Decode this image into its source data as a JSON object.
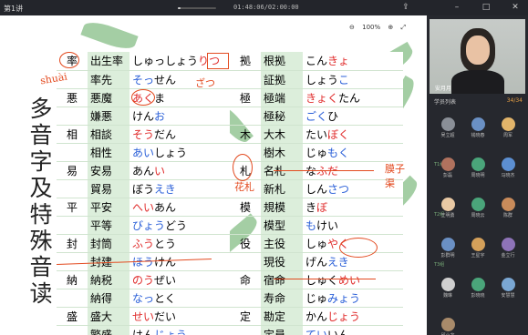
{
  "window": {
    "title": "第1讲",
    "timer": "01:48:06/02:00:00",
    "progress_fraction": 0.08
  },
  "window_icons": [
    "share-icon",
    "minimize-icon",
    "maximize-icon",
    "close-icon"
  ],
  "toolbar": {
    "zoom": "100%"
  },
  "slide": {
    "vertical_title": "多音字及特殊音读",
    "left_rows": [
      {
        "head": "率",
        "word": "出生率",
        "reading": [
          [
            "しゅっしょう",
            ""
          ],
          [
            "りつ",
            "red"
          ]
        ]
      },
      {
        "head": "",
        "word": "率先",
        "reading": [
          [
            "そっ",
            "blue"
          ],
          [
            "せん",
            ""
          ]
        ]
      },
      {
        "head": "悪",
        "word": "悪魔",
        "reading": [
          [
            "あく",
            "red"
          ],
          [
            "ま",
            ""
          ]
        ]
      },
      {
        "head": "",
        "word": "嫌悪",
        "reading": [
          [
            "けん",
            ""
          ],
          [
            "お",
            "blue"
          ]
        ]
      },
      {
        "head": "相",
        "word": "相談",
        "reading": [
          [
            "そう",
            "red"
          ],
          [
            "だん",
            ""
          ]
        ]
      },
      {
        "head": "",
        "word": "相性",
        "reading": [
          [
            "あい",
            "blue"
          ],
          [
            "しょう",
            ""
          ]
        ]
      },
      {
        "head": "易",
        "word": "安易",
        "reading": [
          [
            "あん",
            ""
          ],
          [
            "い",
            "red"
          ]
        ]
      },
      {
        "head": "",
        "word": "貿易",
        "reading": [
          [
            "ぼう",
            ""
          ],
          [
            "えき",
            "blue"
          ]
        ]
      },
      {
        "head": "平",
        "word": "平安",
        "reading": [
          [
            "へい",
            "red"
          ],
          [
            "あん",
            ""
          ]
        ]
      },
      {
        "head": "",
        "word": "平等",
        "reading": [
          [
            "びょう",
            "blue"
          ],
          [
            "どう",
            ""
          ]
        ]
      },
      {
        "head": "封",
        "word": "封筒",
        "reading": [
          [
            "ふう",
            "red"
          ],
          [
            "とう",
            ""
          ]
        ]
      },
      {
        "head": "",
        "word": "封建",
        "reading": [
          [
            "ほう",
            "blue"
          ],
          [
            "けん",
            ""
          ]
        ]
      },
      {
        "head": "納",
        "word": "納税",
        "reading": [
          [
            "のう",
            "red"
          ],
          [
            "ぜい",
            ""
          ]
        ]
      },
      {
        "head": "",
        "word": "納得",
        "reading": [
          [
            "なっ",
            "blue"
          ],
          [
            "とく",
            ""
          ]
        ]
      },
      {
        "head": "盛",
        "word": "盛大",
        "reading": [
          [
            "せい",
            "red"
          ],
          [
            "だい",
            ""
          ]
        ]
      },
      {
        "head": "",
        "word": "繁盛",
        "reading": [
          [
            "はん",
            ""
          ],
          [
            "じょう",
            "blue"
          ]
        ]
      }
    ],
    "right_rows": [
      {
        "head": "拠",
        "word": "根拠",
        "reading": [
          [
            "こん",
            ""
          ],
          [
            "きょ",
            "red"
          ]
        ]
      },
      {
        "head": "",
        "word": "証拠",
        "reading": [
          [
            "しょう",
            ""
          ],
          [
            "こ",
            "blue"
          ]
        ]
      },
      {
        "head": "極",
        "word": "極端",
        "reading": [
          [
            "きょく",
            "red"
          ],
          [
            "たん",
            ""
          ]
        ]
      },
      {
        "head": "",
        "word": "極秘",
        "reading": [
          [
            "ごく",
            "blue"
          ],
          [
            "ひ",
            ""
          ]
        ]
      },
      {
        "head": "木",
        "word": "大木",
        "reading": [
          [
            "たい",
            ""
          ],
          [
            "ぼく",
            "red"
          ]
        ]
      },
      {
        "head": "",
        "word": "樹木",
        "reading": [
          [
            "じゅ",
            ""
          ],
          [
            "もく",
            "blue"
          ]
        ]
      },
      {
        "head": "札",
        "word": "名札",
        "reading": [
          [
            "な",
            ""
          ],
          [
            "ふだ",
            "red"
          ]
        ]
      },
      {
        "head": "",
        "word": "新札",
        "reading": [
          [
            "しん",
            ""
          ],
          [
            "さつ",
            "blue"
          ]
        ]
      },
      {
        "head": "模",
        "word": "規模",
        "reading": [
          [
            "き",
            ""
          ],
          [
            "ぼ",
            "red"
          ]
        ]
      },
      {
        "head": "",
        "word": "模型",
        "reading": [
          [
            "も",
            "blue"
          ],
          [
            "けい",
            ""
          ]
        ]
      },
      {
        "head": "役",
        "word": "主役",
        "reading": [
          [
            "しゅ",
            ""
          ],
          [
            "やく",
            "red"
          ]
        ]
      },
      {
        "head": "",
        "word": "現役",
        "reading": [
          [
            "げん",
            ""
          ],
          [
            "えき",
            "blue"
          ]
        ]
      },
      {
        "head": "命",
        "word": "宿命",
        "reading": [
          [
            "しゅく",
            ""
          ],
          [
            "めい",
            "red"
          ]
        ]
      },
      {
        "head": "",
        "word": "寿命",
        "reading": [
          [
            "じゅ",
            ""
          ],
          [
            "みょう",
            "blue"
          ]
        ]
      },
      {
        "head": "定",
        "word": "勘定",
        "reading": [
          [
            "かん",
            ""
          ],
          [
            "じょう",
            "red"
          ]
        ]
      },
      {
        "head": "",
        "word": "定員",
        "reading": [
          [
            "てい",
            "blue"
          ],
          [
            "いん",
            ""
          ]
        ]
      }
    ],
    "annotations": {
      "shuai": "shuài",
      "zhaku": "ざつ",
      "huazha": "花札",
      "hanzi": "膜子\n渠"
    }
  },
  "panel": {
    "teacher_name": "安月月",
    "list_title": "学员列表",
    "count": "34/34",
    "group1": "T1组",
    "group2": "T2组",
    "group3": "T3组",
    "students": [
      {
        "name": "吴立超",
        "color": "#8a8f97"
      },
      {
        "name": "钱晓春",
        "color": "#6a90c4"
      },
      {
        "name": "周军",
        "color": "#e2b46a"
      },
      {
        "name": "彭磊",
        "color": "#b0725e"
      },
      {
        "name": "周晓明",
        "color": "#4aa57a"
      },
      {
        "name": "马晓杰",
        "color": "#5c8fd2"
      },
      {
        "name": "王明勇",
        "color": "#e9c9a4"
      },
      {
        "name": "周晓云",
        "color": "#4aa57a"
      },
      {
        "name": "陈群",
        "color": "#c98b5a"
      },
      {
        "name": "彭群明",
        "color": "#6a90c4"
      },
      {
        "name": "王星宇",
        "color": "#d4a05a"
      },
      {
        "name": "金立行",
        "color": "#8e73b8"
      },
      {
        "name": "魏琳",
        "color": "#cfcfcf"
      },
      {
        "name": "彭晓晓",
        "color": "#4aa57a"
      },
      {
        "name": "安慧慧",
        "color": "#7aa7d4"
      },
      {
        "name": "邱小龙",
        "color": "#a88a6a"
      }
    ]
  }
}
